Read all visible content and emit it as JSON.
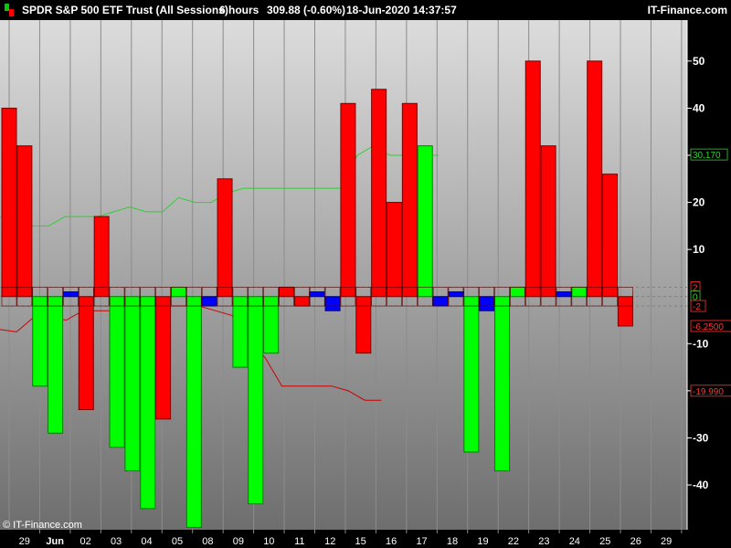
{
  "header": {
    "title": "SPDR S&P 500 ETF Trust (All Sessions)",
    "timeframe": "6 hours",
    "quote": "309.88 (-0.60%)",
    "datetime": "18-Jun-2020 14:37:57",
    "site": "IT-Finance.com"
  },
  "footer": {
    "watermark": "© IT-Finance.com"
  },
  "colors": {
    "up": "#00ff00",
    "down": "#ff0000",
    "neutral": "#0000ff",
    "upper_line": "#2ed12e",
    "lower_line": "#cc0000"
  },
  "chart_data": {
    "type": "bar",
    "y_range": [
      -49.5,
      58.7
    ],
    "y_ticks": [
      "50",
      "40",
      "30",
      "20",
      "10",
      "-10",
      "-20",
      "-30",
      "-40"
    ],
    "x_labels": [
      "29",
      "Jun",
      "02",
      "03",
      "04",
      "05",
      "08",
      "09",
      "10",
      "11",
      "12",
      "15",
      "16",
      "17",
      "18",
      "19",
      "22",
      "23",
      "24",
      "25",
      "26",
      "29"
    ],
    "bars": [
      {
        "value": 40,
        "color": "red"
      },
      {
        "value": 32,
        "color": "red"
      },
      {
        "value": -19,
        "color": "green"
      },
      {
        "value": -29,
        "color": "green"
      },
      {
        "value": 1,
        "color": "blue"
      },
      {
        "value": -24,
        "color": "red"
      },
      {
        "value": 17,
        "color": "red"
      },
      {
        "value": -32,
        "color": "green"
      },
      {
        "value": -37,
        "color": "green"
      },
      {
        "value": -45,
        "color": "green"
      },
      {
        "value": -26,
        "color": "red"
      },
      {
        "value": 2,
        "color": "green"
      },
      {
        "value": -49,
        "color": "green"
      },
      {
        "value": -2,
        "color": "blue"
      },
      {
        "value": 25,
        "color": "red"
      },
      {
        "value": -15,
        "color": "green"
      },
      {
        "value": -44,
        "color": "green"
      },
      {
        "value": -12,
        "color": "green"
      },
      {
        "value": 2,
        "color": "red"
      },
      {
        "value": -2,
        "color": "red"
      },
      {
        "value": 1,
        "color": "blue"
      },
      {
        "value": -3,
        "color": "blue"
      },
      {
        "value": 41,
        "color": "red"
      },
      {
        "value": -12,
        "color": "red"
      },
      {
        "value": 44,
        "color": "red"
      },
      {
        "value": 20,
        "color": "red"
      },
      {
        "value": 41,
        "color": "red"
      },
      {
        "value": 32,
        "color": "green"
      },
      {
        "value": -2,
        "color": "blue"
      },
      {
        "value": 1,
        "color": "blue"
      },
      {
        "value": -33,
        "color": "green"
      },
      {
        "value": -3,
        "color": "blue"
      },
      {
        "value": -37,
        "color": "green"
      },
      {
        "value": 2,
        "color": "green"
      },
      {
        "value": 50,
        "color": "red"
      },
      {
        "value": 32,
        "color": "red"
      },
      {
        "value": 1,
        "color": "blue"
      },
      {
        "value": 2,
        "color": "green"
      },
      {
        "value": 50,
        "color": "red"
      },
      {
        "value": 26,
        "color": "red"
      },
      {
        "value": -6.25,
        "color": "red"
      }
    ],
    "upper_line": [
      17,
      15,
      15,
      15,
      17,
      17,
      17,
      18,
      19,
      18,
      18,
      21,
      20,
      20,
      22,
      23,
      23,
      23,
      23,
      23,
      23,
      23,
      30,
      32,
      30,
      30,
      30,
      30
    ],
    "lower_line": [
      -7,
      -7.5,
      -4.5,
      -4.5,
      -5,
      -3,
      -3,
      -3,
      -2,
      -2,
      -2,
      -2,
      -2,
      -3,
      -4,
      -9,
      -13,
      -19,
      -19,
      -19,
      -19,
      -20,
      -22,
      -22
    ],
    "mid_band": [
      2,
      0,
      -2
    ],
    "right_labels": [
      {
        "text": "30.170",
        "value": 30.17,
        "color": "#2ed12e"
      },
      {
        "text": "2",
        "value": 2,
        "color": "#ff3333"
      },
      {
        "text": "0",
        "value": 0,
        "color": "#2ed12e"
      },
      {
        "text": "-2",
        "value": -2,
        "color": "#ff3333"
      },
      {
        "text": "-6.2500",
        "value": -6.25,
        "color": "#ff3333"
      },
      {
        "text": "-19.990",
        "value": -19.99,
        "color": "#ff3333"
      }
    ]
  }
}
